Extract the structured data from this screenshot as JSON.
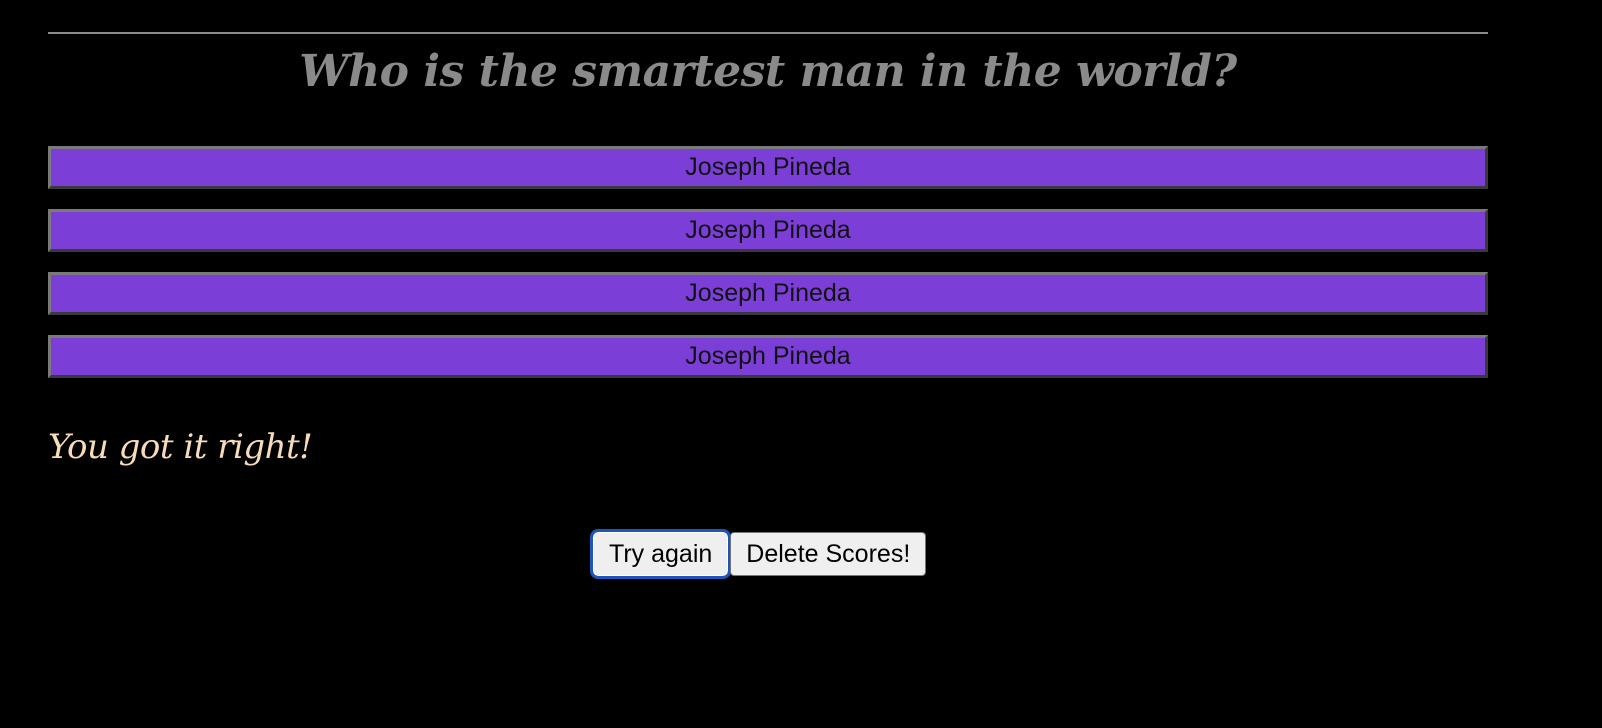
{
  "quiz": {
    "question": "Who is the smartest man in the world?",
    "answers": [
      "Joseph Pineda",
      "Joseph Pineda",
      "Joseph Pineda",
      "Joseph Pineda"
    ],
    "result_message": "You got it right!"
  },
  "controls": {
    "try_again_label": "Try again",
    "delete_scores_label": "Delete Scores!"
  },
  "colors": {
    "background": "#000000",
    "answer_button": "#7b3fd8",
    "question_text": "#8a8a8a",
    "result_text": "#f6dcb8",
    "focus_ring": "#1d55b8"
  }
}
